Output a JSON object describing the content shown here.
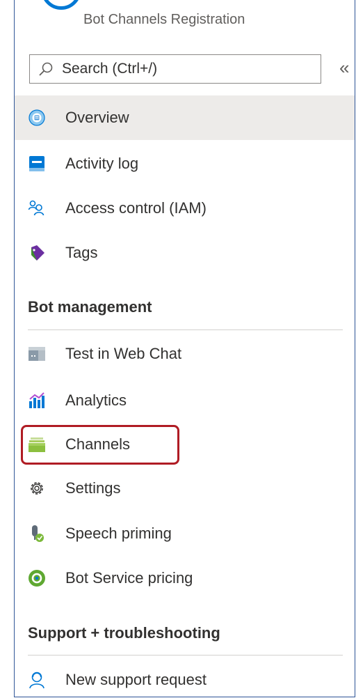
{
  "header": {
    "resource_type": "Bot Channels Registration"
  },
  "search": {
    "placeholder": "Search (Ctrl+/)",
    "collapse_label": "«"
  },
  "nav": {
    "overview": "Overview",
    "activity_log": "Activity log",
    "access_control": "Access control (IAM)",
    "tags": "Tags"
  },
  "sections": {
    "bot_management": {
      "title": "Bot management",
      "items": {
        "test_web_chat": "Test in Web Chat",
        "analytics": "Analytics",
        "channels": "Channels",
        "settings": "Settings",
        "speech_priming": "Speech priming",
        "pricing": "Bot Service pricing"
      }
    },
    "support": {
      "title": "Support + troubleshooting",
      "items": {
        "new_support_request": "New support request"
      }
    }
  },
  "colors": {
    "accent": "#0078d4",
    "highlight_outline": "#b01c24",
    "active_background": "#edebe9"
  }
}
